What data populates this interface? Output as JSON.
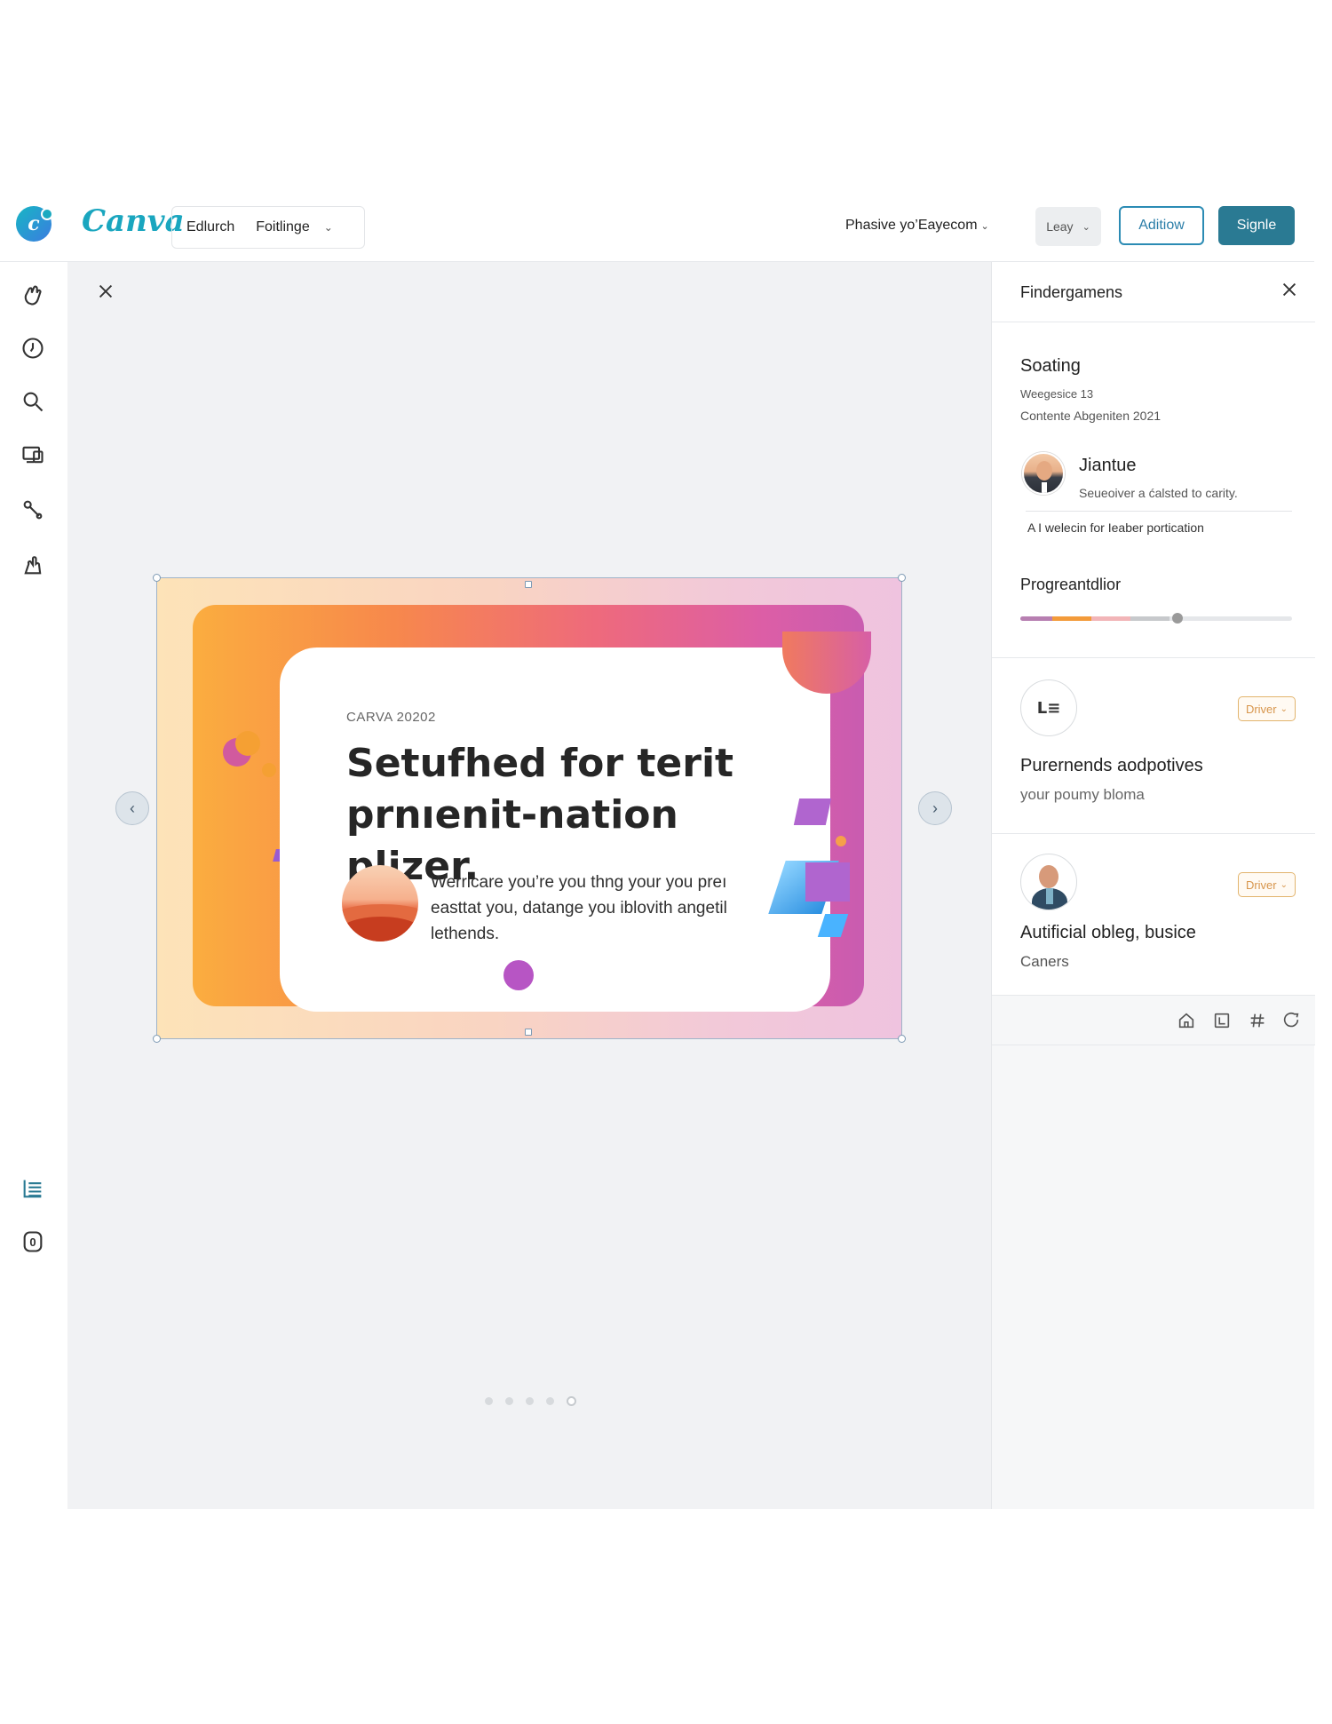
{
  "brand": {
    "name": "Canva",
    "icon": "canva-app-icon"
  },
  "topbar": {
    "menu": [
      {
        "label": "Edlurch"
      },
      {
        "label": "Foitlinge"
      }
    ],
    "account_link": "Phasive yo’Eayecom",
    "select_value": "Leay",
    "outline_button": "Aditiow",
    "primary_button": "Signle"
  },
  "rail": {
    "icons": [
      "hand-icon",
      "clock-icon",
      "search-icon",
      "devices-icon",
      "brush-icon",
      "touch-icon"
    ],
    "bottom_icons": [
      "list-icon",
      "counter-icon"
    ],
    "counter_value": "0"
  },
  "slide": {
    "kicker": "CARVA 20202",
    "title": "Setufhed for terit prnıenit-nation plizer.",
    "body": "Werricare you’re you thng your you preı easttat you, datange you iblovith angetil lethends.",
    "page_dots": 5,
    "active_dot": 5
  },
  "panel": {
    "title": "Findergamens",
    "section": {
      "heading": "Soating",
      "meta1": "Weegesice 13",
      "meta2": "Contente Abgeniten 2021"
    },
    "user": {
      "name": "Jiantue",
      "subtitle": "Seueoiver a ćalsted to carity."
    },
    "note": "A I  welecin for Ieaber portication",
    "progress": {
      "label": "Progreantdlior",
      "value": 0.58
    },
    "cards": [
      {
        "icon_text": "L≡",
        "badge": "Driver",
        "title": "Purernends aodpotives",
        "subtitle": "your poumy bloma"
      },
      {
        "badge": "Driver",
        "title": "Autificial obleg, busice",
        "subtitle": "Caners"
      }
    ],
    "tools": [
      "home-icon",
      "layout-icon",
      "hash-icon",
      "comment-icon"
    ]
  },
  "colors": {
    "brand": "#1aa6bf",
    "primary_button": "#2a7a93",
    "outline_button": "#2b8bb4",
    "badge": "#d7954b",
    "canvas_bg": "#f1f2f4"
  }
}
